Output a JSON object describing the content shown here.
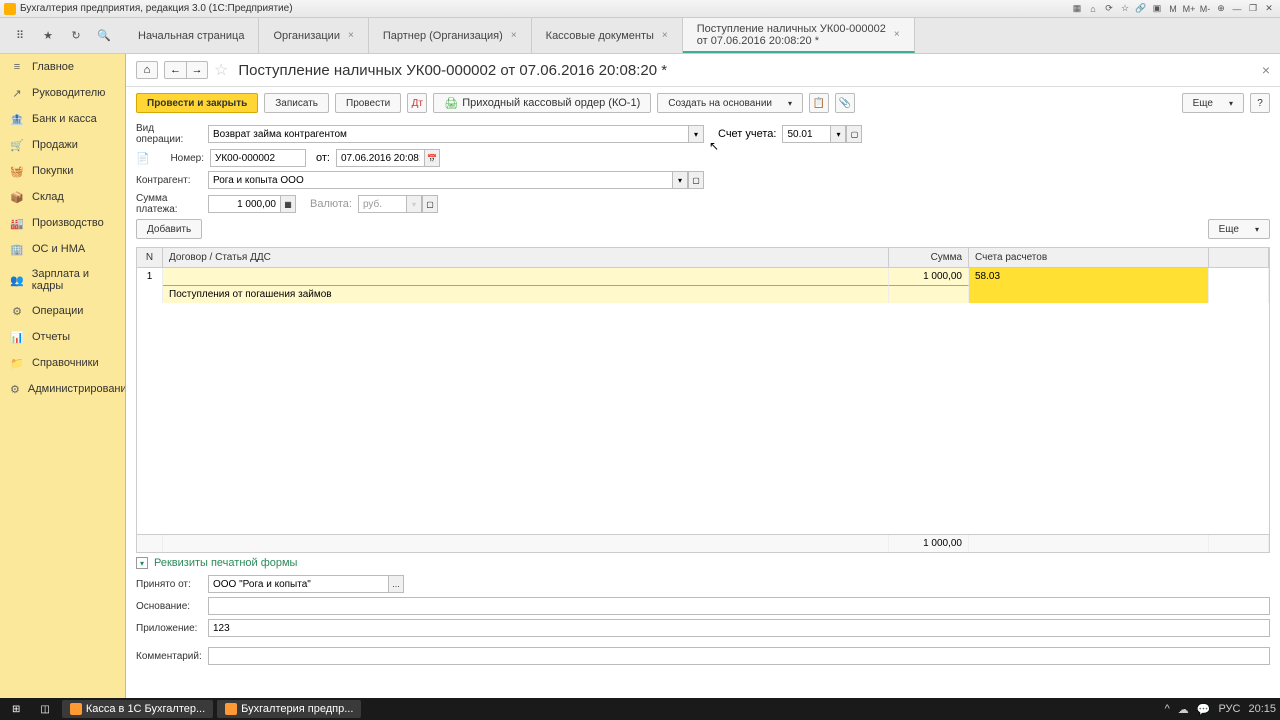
{
  "titlebar": {
    "text": "Бухгалтерия предприятия, редакция 3.0 (1С:Предприятие)",
    "btn_m": "М",
    "btn_mplus": "М+",
    "btn_mminus": "М-"
  },
  "tabs": {
    "start": "Начальная страница",
    "org": "Организации",
    "partner": "Партнер (Организация)",
    "cash_docs": "Кассовые документы",
    "active_l1": "Поступление наличных УК00-000002",
    "active_l2": "от 07.06.2016 20:08:20 *"
  },
  "sidebar": {
    "main": "Главное",
    "manager": "Руководителю",
    "bank": "Банк и касса",
    "sales": "Продажи",
    "purchases": "Покупки",
    "warehouse": "Склад",
    "production": "Производство",
    "os": "ОС и НМА",
    "salary": "Зарплата и кадры",
    "operations": "Операции",
    "reports": "Отчеты",
    "catalogs": "Справочники",
    "admin": "Администрирование"
  },
  "header": {
    "title": "Поступление наличных УК00-000002 от 07.06.2016 20:08:20 *"
  },
  "actions": {
    "post_close": "Провести и закрыть",
    "save": "Записать",
    "post": "Провести",
    "pko": "Приходный кассовый ордер (КО-1)",
    "create_based": "Создать на основании",
    "more": "Еще",
    "help": "?"
  },
  "form": {
    "op_type_label": "Вид операции:",
    "op_type_value": "Возврат займа контрагентом",
    "account_label": "Счет учета:",
    "account_value": "50.01",
    "number_label": "Номер:",
    "number_value": "УК00-000002",
    "date_label": "от:",
    "date_value": "07.06.2016 20:08:20",
    "contractor_label": "Контрагент:",
    "contractor_value": "Рога и копыта ООО",
    "amount_label": "Сумма платежа:",
    "amount_value": "1 000,00",
    "currency_label": "Валюта:",
    "currency_value": "руб.",
    "add_btn": "Добавить",
    "more_btn": "Еще"
  },
  "table": {
    "col_n": "N",
    "col_desc": "Договор / Статья ДДС",
    "col_sum": "Сумма",
    "col_acc": "Счета расчетов",
    "row1_n": "1",
    "row1_desc": "",
    "row1_sum": "1 000,00",
    "row1_acc": "58.03",
    "row2_desc": "Поступления от погашения займов",
    "footer_sum": "1 000,00"
  },
  "details": {
    "header": "Реквизиты печатной формы",
    "from_label": "Принято от:",
    "from_value": "ООО \"Рога и копыта\"",
    "basis_label": "Основание:",
    "basis_value": "",
    "attachment_label": "Приложение:",
    "attachment_value": "123",
    "comment_label": "Комментарий:",
    "comment_value": ""
  },
  "taskbar": {
    "app1": "Касса в 1С Бухгалтер...",
    "app2": "Бухгалтерия предпр...",
    "lang": "РУС",
    "time": "20:15"
  }
}
